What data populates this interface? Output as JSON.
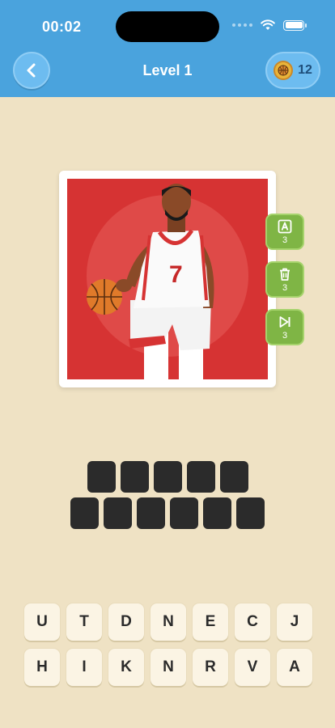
{
  "status_bar": {
    "time": "00:02"
  },
  "header": {
    "title": "Level 1",
    "coins": "12"
  },
  "hints": [
    {
      "name": "reveal-letter",
      "count": "3"
    },
    {
      "name": "remove-letters",
      "count": "3"
    },
    {
      "name": "skip-level",
      "count": "3"
    }
  ],
  "player_jersey_number": "7",
  "answer": {
    "row1_slots": 5,
    "row2_slots": 6
  },
  "keyboard": {
    "row1": [
      "U",
      "T",
      "D",
      "N",
      "E",
      "C",
      "J"
    ],
    "row2": [
      "H",
      "I",
      "K",
      "N",
      "R",
      "V",
      "A"
    ]
  },
  "colors": {
    "header": "#4aa3dd",
    "background": "#efe2c4",
    "hint_green": "#7fb545",
    "photo_bg": "#d63333",
    "slot": "#2b2b2b"
  }
}
